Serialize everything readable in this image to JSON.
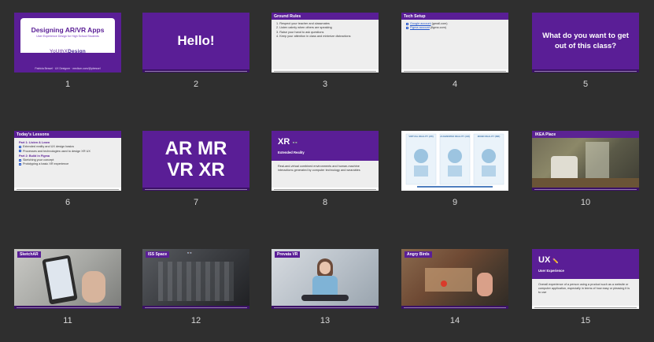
{
  "slides": [
    {
      "number": "1",
      "title": "Designing AR/VR Apps",
      "subtitle": "User Experience Design for High School Students",
      "logo_pre": "YoUthX",
      "logo_post": "Design",
      "author": "Patricia Bessel · UX Designer · medium.com/@pbessel"
    },
    {
      "number": "2",
      "heading": "Hello!"
    },
    {
      "number": "3",
      "header": "Ground Rules",
      "items": [
        "1.  Respect your teacher and classmates",
        "2.  Listen calmly when others are speaking",
        "3.  Raise your hand to ask questions",
        "4.  Keep your attention in class and minimize distractions"
      ]
    },
    {
      "number": "4",
      "header": "Tech Setup",
      "items": [
        "Google account",
        "Figma account"
      ],
      "notes": [
        " (gmail.com)",
        " (figma.com)"
      ]
    },
    {
      "number": "5",
      "heading": "What do you want to get out of this class?"
    },
    {
      "number": "6",
      "header": "Today's Lessons",
      "part1": "Part 1: Listen & Learn",
      "part1_items": [
        "Extended reality and UX design basics",
        "Processes and technologies used to design XR UX"
      ],
      "part2": "Part 2: Build in Figma",
      "part2_items": [
        "Sketching your concept",
        "Prototyping a basic XR experience"
      ]
    },
    {
      "number": "7",
      "line1": "AR MR",
      "line2": "VR XR"
    },
    {
      "number": "8",
      "title": "XR",
      "emoji": "👓",
      "subtitle": "Extended Reality",
      "body": "Real-and-virtual combined environments and human-machine interactions generated by computer technology and wearables"
    },
    {
      "number": "9",
      "col_labels": [
        "VIRTUAL REALITY (VR)",
        "AUGMENTED REALITY (AR)",
        "MIXED REALITY (MR)"
      ]
    },
    {
      "number": "10",
      "header": "IKEA Place"
    },
    {
      "number": "11",
      "header": "SketchAR"
    },
    {
      "number": "12",
      "header": "ISS Space",
      "emoji": "👓"
    },
    {
      "number": "13",
      "header": "Prevata VR"
    },
    {
      "number": "14",
      "header": "Angry Birds"
    },
    {
      "number": "15",
      "title": "UX",
      "emoji": "✏️",
      "subtitle": "User Experience",
      "body": "Overall experience of a person using a product such as a website or computer application, especially in terms of how easy or pleasing it is to use"
    }
  ],
  "colors": {
    "brand_purple": "#5a1e96",
    "background": "#2f2f2f"
  }
}
